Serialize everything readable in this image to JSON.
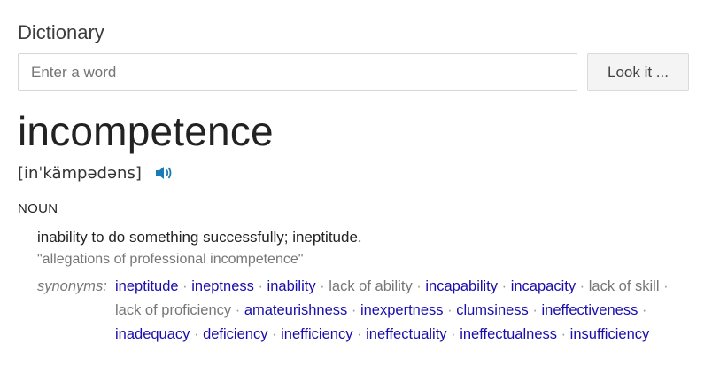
{
  "dictionary": {
    "title": "Dictionary",
    "search": {
      "placeholder": "Enter a word",
      "value": ""
    },
    "lookup_button_label": "Look it ..."
  },
  "entry": {
    "word": "incompetence",
    "pronunciation": "[inˈkämpədəns]",
    "part_of_speech": "NOUN",
    "definition": "inability to do something successfully; ineptitude.",
    "example": "\"allegations of professional incompetence\"",
    "synonyms_label": "synonyms:",
    "synonyms": [
      {
        "text": "ineptitude",
        "link": true
      },
      {
        "text": "ineptness",
        "link": true
      },
      {
        "text": "inability",
        "link": true
      },
      {
        "text": "lack of ability",
        "link": false
      },
      {
        "text": "incapability",
        "link": true
      },
      {
        "text": "incapacity",
        "link": true
      },
      {
        "text": "lack of skill",
        "link": false
      },
      {
        "text": "lack of proficiency",
        "link": false
      },
      {
        "text": "amateurishness",
        "link": true
      },
      {
        "text": "inexpertness",
        "link": true
      },
      {
        "text": "clumsiness",
        "link": true
      },
      {
        "text": "ineffectiveness",
        "link": true
      },
      {
        "text": "inadequacy",
        "link": true
      },
      {
        "text": "deficiency",
        "link": true
      },
      {
        "text": "inefficiency",
        "link": true
      },
      {
        "text": "ineffectuality",
        "link": true
      },
      {
        "text": "ineffectualness",
        "link": true
      },
      {
        "text": "insufficiency",
        "link": true
      }
    ]
  },
  "icons": {
    "speaker": "speaker-icon"
  },
  "colors": {
    "link": "#1a0dab",
    "speaker": "#1a7bb9",
    "muted": "#777777"
  }
}
